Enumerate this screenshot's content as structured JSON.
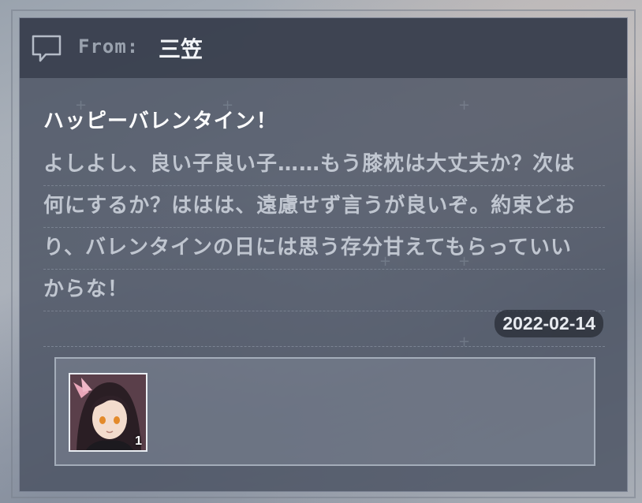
{
  "mail": {
    "from_label": "From:",
    "from_name": "三笠",
    "title": "ハッピーバレンタイン！",
    "body_lines": [
      "よしよし、良い子良い子……もう膝枕は大丈夫か？次は",
      "何にするか？ははは、遠慮せず言うが良いぞ。約束どお",
      "り、バレンタインの日には思う存分甘えてもらっていい",
      "からな！"
    ],
    "date": "2022-02-14"
  },
  "attachment": {
    "item_icon": "character-portrait-icon",
    "item_count": "1"
  },
  "icons": {
    "header_icon": "message-bubble-icon"
  }
}
